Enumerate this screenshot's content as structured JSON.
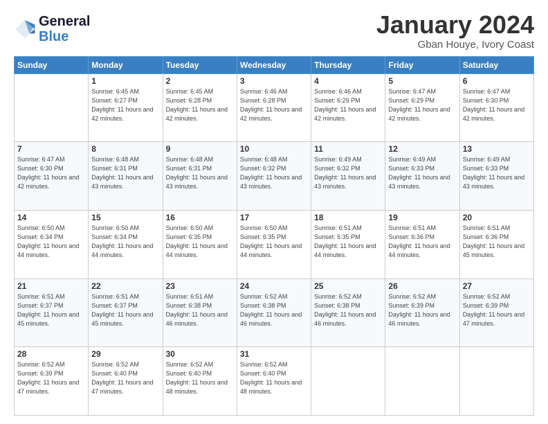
{
  "logo": {
    "text_general": "General",
    "text_blue": "Blue"
  },
  "header": {
    "month_year": "January 2024",
    "location": "Gban Houye, Ivory Coast"
  },
  "days_of_week": [
    "Sunday",
    "Monday",
    "Tuesday",
    "Wednesday",
    "Thursday",
    "Friday",
    "Saturday"
  ],
  "weeks": [
    [
      {
        "day": "",
        "sunrise": "",
        "sunset": "",
        "daylight": ""
      },
      {
        "day": "1",
        "sunrise": "Sunrise: 6:45 AM",
        "sunset": "Sunset: 6:27 PM",
        "daylight": "Daylight: 11 hours and 42 minutes."
      },
      {
        "day": "2",
        "sunrise": "Sunrise: 6:45 AM",
        "sunset": "Sunset: 6:28 PM",
        "daylight": "Daylight: 11 hours and 42 minutes."
      },
      {
        "day": "3",
        "sunrise": "Sunrise: 6:46 AM",
        "sunset": "Sunset: 6:28 PM",
        "daylight": "Daylight: 11 hours and 42 minutes."
      },
      {
        "day": "4",
        "sunrise": "Sunrise: 6:46 AM",
        "sunset": "Sunset: 6:29 PM",
        "daylight": "Daylight: 11 hours and 42 minutes."
      },
      {
        "day": "5",
        "sunrise": "Sunrise: 6:47 AM",
        "sunset": "Sunset: 6:29 PM",
        "daylight": "Daylight: 11 hours and 42 minutes."
      },
      {
        "day": "6",
        "sunrise": "Sunrise: 6:47 AM",
        "sunset": "Sunset: 6:30 PM",
        "daylight": "Daylight: 11 hours and 42 minutes."
      }
    ],
    [
      {
        "day": "7",
        "sunrise": "Sunrise: 6:47 AM",
        "sunset": "Sunset: 6:30 PM",
        "daylight": "Daylight: 11 hours and 42 minutes."
      },
      {
        "day": "8",
        "sunrise": "Sunrise: 6:48 AM",
        "sunset": "Sunset: 6:31 PM",
        "daylight": "Daylight: 11 hours and 43 minutes."
      },
      {
        "day": "9",
        "sunrise": "Sunrise: 6:48 AM",
        "sunset": "Sunset: 6:31 PM",
        "daylight": "Daylight: 11 hours and 43 minutes."
      },
      {
        "day": "10",
        "sunrise": "Sunrise: 6:48 AM",
        "sunset": "Sunset: 6:32 PM",
        "daylight": "Daylight: 11 hours and 43 minutes."
      },
      {
        "day": "11",
        "sunrise": "Sunrise: 6:49 AM",
        "sunset": "Sunset: 6:32 PM",
        "daylight": "Daylight: 11 hours and 43 minutes."
      },
      {
        "day": "12",
        "sunrise": "Sunrise: 6:49 AM",
        "sunset": "Sunset: 6:33 PM",
        "daylight": "Daylight: 11 hours and 43 minutes."
      },
      {
        "day": "13",
        "sunrise": "Sunrise: 6:49 AM",
        "sunset": "Sunset: 6:33 PM",
        "daylight": "Daylight: 11 hours and 43 minutes."
      }
    ],
    [
      {
        "day": "14",
        "sunrise": "Sunrise: 6:50 AM",
        "sunset": "Sunset: 6:34 PM",
        "daylight": "Daylight: 11 hours and 44 minutes."
      },
      {
        "day": "15",
        "sunrise": "Sunrise: 6:50 AM",
        "sunset": "Sunset: 6:34 PM",
        "daylight": "Daylight: 11 hours and 44 minutes."
      },
      {
        "day": "16",
        "sunrise": "Sunrise: 6:50 AM",
        "sunset": "Sunset: 6:35 PM",
        "daylight": "Daylight: 11 hours and 44 minutes."
      },
      {
        "day": "17",
        "sunrise": "Sunrise: 6:50 AM",
        "sunset": "Sunset: 6:35 PM",
        "daylight": "Daylight: 11 hours and 44 minutes."
      },
      {
        "day": "18",
        "sunrise": "Sunrise: 6:51 AM",
        "sunset": "Sunset: 6:35 PM",
        "daylight": "Daylight: 11 hours and 44 minutes."
      },
      {
        "day": "19",
        "sunrise": "Sunrise: 6:51 AM",
        "sunset": "Sunset: 6:36 PM",
        "daylight": "Daylight: 11 hours and 44 minutes."
      },
      {
        "day": "20",
        "sunrise": "Sunrise: 6:51 AM",
        "sunset": "Sunset: 6:36 PM",
        "daylight": "Daylight: 11 hours and 45 minutes."
      }
    ],
    [
      {
        "day": "21",
        "sunrise": "Sunrise: 6:51 AM",
        "sunset": "Sunset: 6:37 PM",
        "daylight": "Daylight: 11 hours and 45 minutes."
      },
      {
        "day": "22",
        "sunrise": "Sunrise: 6:51 AM",
        "sunset": "Sunset: 6:37 PM",
        "daylight": "Daylight: 11 hours and 45 minutes."
      },
      {
        "day": "23",
        "sunrise": "Sunrise: 6:51 AM",
        "sunset": "Sunset: 6:38 PM",
        "daylight": "Daylight: 11 hours and 46 minutes."
      },
      {
        "day": "24",
        "sunrise": "Sunrise: 6:52 AM",
        "sunset": "Sunset: 6:38 PM",
        "daylight": "Daylight: 11 hours and 46 minutes."
      },
      {
        "day": "25",
        "sunrise": "Sunrise: 6:52 AM",
        "sunset": "Sunset: 6:38 PM",
        "daylight": "Daylight: 11 hours and 46 minutes."
      },
      {
        "day": "26",
        "sunrise": "Sunrise: 6:52 AM",
        "sunset": "Sunset: 6:39 PM",
        "daylight": "Daylight: 11 hours and 46 minutes."
      },
      {
        "day": "27",
        "sunrise": "Sunrise: 6:52 AM",
        "sunset": "Sunset: 6:39 PM",
        "daylight": "Daylight: 11 hours and 47 minutes."
      }
    ],
    [
      {
        "day": "28",
        "sunrise": "Sunrise: 6:52 AM",
        "sunset": "Sunset: 6:39 PM",
        "daylight": "Daylight: 11 hours and 47 minutes."
      },
      {
        "day": "29",
        "sunrise": "Sunrise: 6:52 AM",
        "sunset": "Sunset: 6:40 PM",
        "daylight": "Daylight: 11 hours and 47 minutes."
      },
      {
        "day": "30",
        "sunrise": "Sunrise: 6:52 AM",
        "sunset": "Sunset: 6:40 PM",
        "daylight": "Daylight: 11 hours and 48 minutes."
      },
      {
        "day": "31",
        "sunrise": "Sunrise: 6:52 AM",
        "sunset": "Sunset: 6:40 PM",
        "daylight": "Daylight: 11 hours and 48 minutes."
      },
      {
        "day": "",
        "sunrise": "",
        "sunset": "",
        "daylight": ""
      },
      {
        "day": "",
        "sunrise": "",
        "sunset": "",
        "daylight": ""
      },
      {
        "day": "",
        "sunrise": "",
        "sunset": "",
        "daylight": ""
      }
    ]
  ]
}
